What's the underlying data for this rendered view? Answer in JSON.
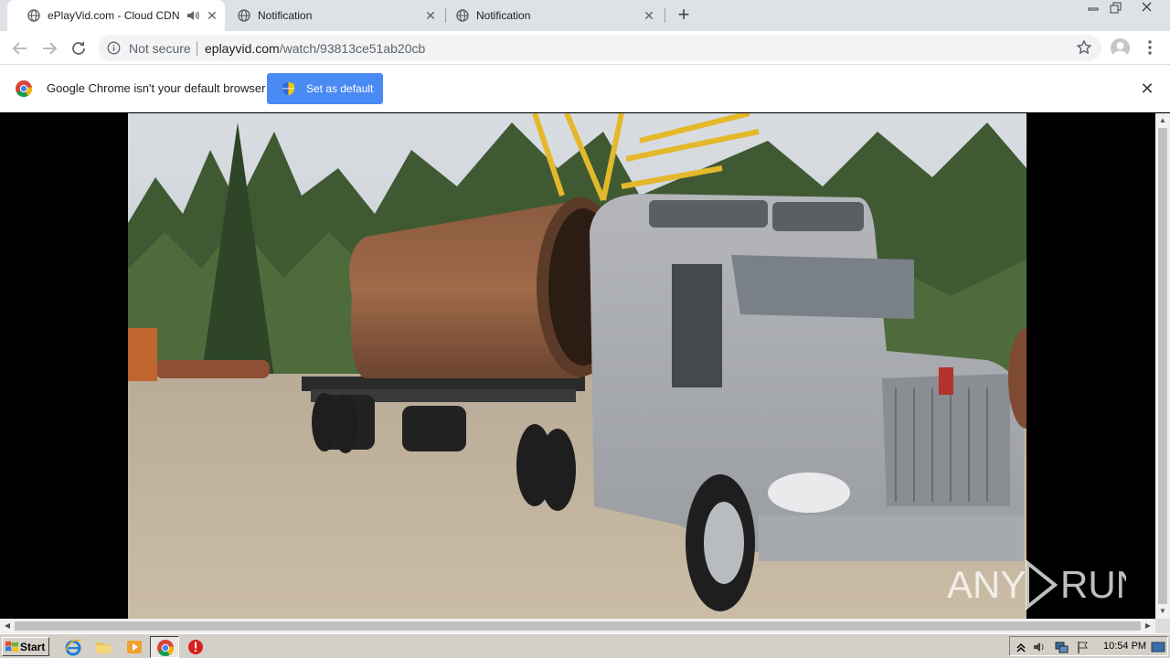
{
  "browser": {
    "tabs": [
      {
        "title": "ePlayVid.com - Cloud CDN",
        "active": true,
        "audio": true
      },
      {
        "title": "Notification",
        "active": false,
        "audio": false
      },
      {
        "title": "Notification",
        "active": false,
        "audio": false
      }
    ],
    "omnibox": {
      "security_label": "Not secure",
      "url_host": "eplayvid.com",
      "url_path": "/watch/93813ce51ab20cb"
    }
  },
  "infobar": {
    "message": "Google Chrome isn't your default browser",
    "button_label": "Set as default"
  },
  "watermark": {
    "text": "ANY RUN"
  },
  "taskbar": {
    "start_label": "Start",
    "clock": "10:54 PM"
  },
  "colors": {
    "tab_strip": "#dee1e6",
    "accent_button": "#4a8af4",
    "taskbar": "#d4d0c8"
  }
}
